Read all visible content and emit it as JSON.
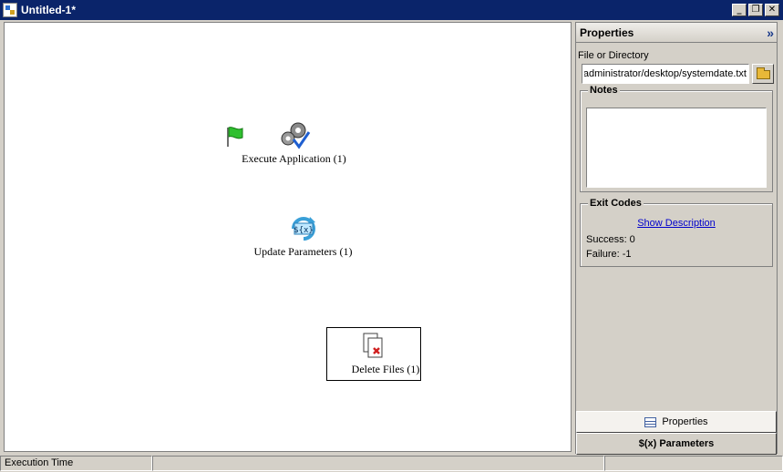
{
  "window": {
    "title": "Untitled-1*",
    "buttons": {
      "minimize": "_",
      "restore": "❐",
      "close": "✕"
    }
  },
  "canvas": {
    "nodes": [
      {
        "label": "Execute Application (1)",
        "icon": "gears-check-icon"
      },
      {
        "label": "Update Parameters (1)",
        "icon": "update-parameters-icon"
      },
      {
        "label": "Delete Files (1)",
        "icon": "delete-files-icon"
      }
    ],
    "start_icon": "green-flag-icon"
  },
  "properties": {
    "header": "Properties",
    "collapse": "»",
    "file_label": "File or Directory",
    "file_value": "administrator/desktop/systemdate.txt",
    "notes_title": "Notes",
    "notes_value": "",
    "exit_codes_title": "Exit Codes",
    "show_description": "Show Description",
    "success": "Success: 0",
    "failure": "Failure: -1",
    "tabs": {
      "properties": "Properties",
      "parameters": "$(x) Parameters"
    }
  },
  "status": {
    "execution_time": "Execution Time"
  },
  "colors": {
    "titlebar": "#0a246a",
    "link": "#0000cc",
    "chrome": "#d4d0c8"
  }
}
